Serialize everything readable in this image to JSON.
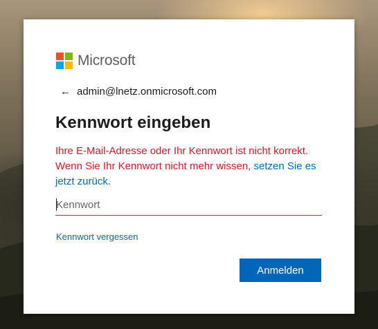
{
  "brand": {
    "name": "Microsoft",
    "logo_colors": [
      "#f25022",
      "#7fba00",
      "#00a4ef",
      "#ffb900"
    ]
  },
  "identity": {
    "back_icon": "←",
    "email": "admin@lnetz.onmicrosoft.com"
  },
  "title": "Kennwort eingeben",
  "error": {
    "text": "Ihre E-Mail-Adresse oder Ihr Kennwort ist nicht korrekt. Wenn Sie Ihr Kennwort nicht mehr wissen,",
    "link": "setzen Sie es jetzt zurück."
  },
  "password": {
    "placeholder": "Kennwort",
    "value": ""
  },
  "forgot_link": "Kennwort vergessen",
  "signin_button": "Anmelden",
  "colors": {
    "accent": "#0067b8",
    "error": "#e81123"
  }
}
